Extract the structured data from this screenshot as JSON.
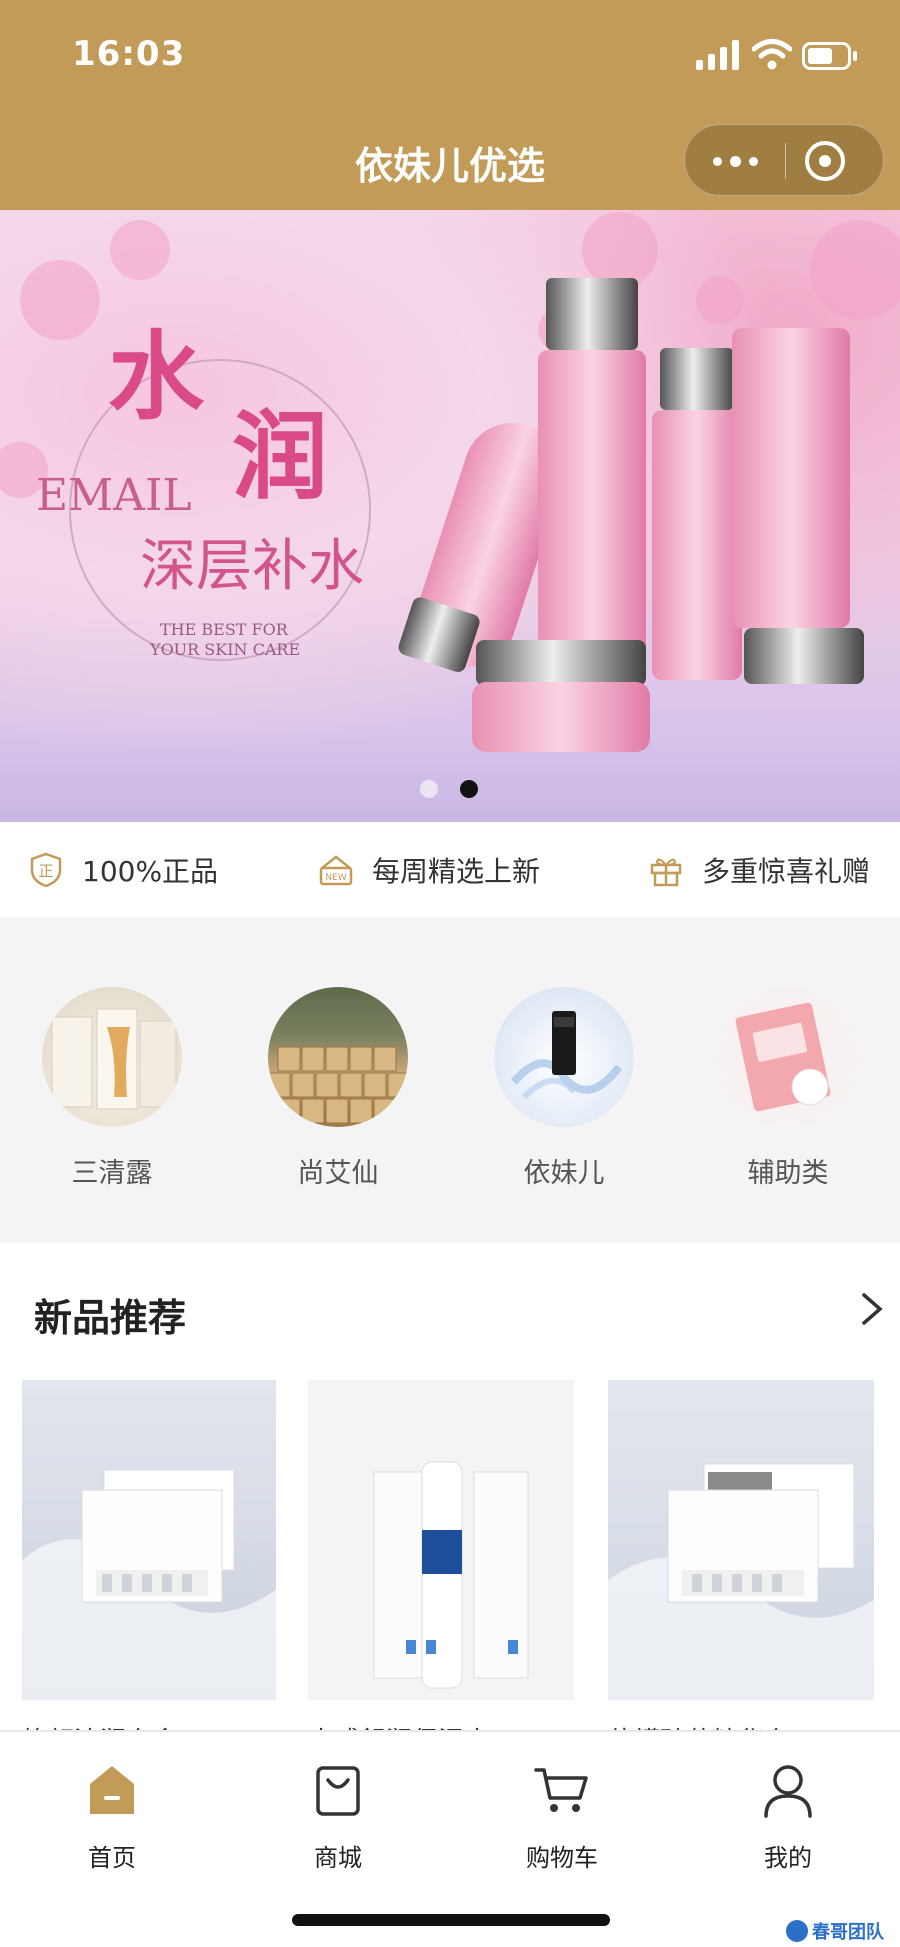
{
  "status_bar": {
    "time": "16:03"
  },
  "nav": {
    "title": "依妹儿优选"
  },
  "banner": {
    "headline_1": "水",
    "headline_2": "润",
    "brand": "EMAIL",
    "subtitle": "深层补水",
    "tagline_1": "THE BEST FOR",
    "tagline_2": "YOUR SKIN CARE",
    "dots": 2,
    "active_dot": 2
  },
  "features": [
    {
      "label": "100%正品",
      "icon": "shield-zheng-icon"
    },
    {
      "label": "每周精选上新",
      "icon": "new-tag-icon"
    },
    {
      "label": "多重惊喜礼赠",
      "icon": "gift-icon"
    }
  ],
  "categories": [
    {
      "label": "三清露"
    },
    {
      "label": "尚艾仙"
    },
    {
      "label": "依妹儿"
    },
    {
      "label": "辅助类"
    }
  ],
  "new_products": {
    "title": "新品推荐",
    "items": [
      {
        "name": "焕颜清润套盒"
      },
      {
        "name": "水感舒润保湿水"
      },
      {
        "name": "倍護臻萃精华套"
      }
    ]
  },
  "tabbar": {
    "items": [
      {
        "label": "首页",
        "icon": "home-icon",
        "active": true
      },
      {
        "label": "商城",
        "icon": "shopping-bag-icon",
        "active": false
      },
      {
        "label": "购物车",
        "icon": "cart-icon",
        "active": false
      },
      {
        "label": "我的",
        "icon": "user-icon",
        "active": false
      }
    ]
  },
  "watermark": {
    "text": "春哥团队"
  },
  "colors": {
    "brand_gold": "#c29b58",
    "banner_pink": "#e47aa6"
  }
}
